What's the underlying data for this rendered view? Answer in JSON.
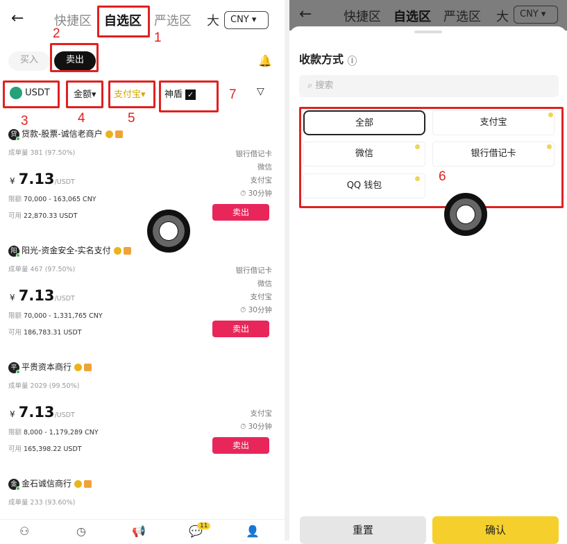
{
  "left": {
    "tabs": [
      "快捷区",
      "自选区",
      "严选区",
      "大"
    ],
    "currency": "CNY",
    "buy_label": "买入",
    "sell_label": "卖出",
    "filters": {
      "coin": "USDT",
      "amount": "金额",
      "payment": "支付宝",
      "shield": "神盾"
    },
    "merchants": [
      {
        "name": "贷款-股票-诚信老商户",
        "avatar": "贷",
        "stats_label": "成单量",
        "stats": "381 (97.50%)",
        "currency_symbol": "¥",
        "price": "7.13",
        "unit": "/USDT",
        "limit_label": "限额",
        "limit": "70,000 - 163,065 CNY",
        "avail_label": "可用",
        "avail": "22,870.33 USDT",
        "payments": [
          "银行借记卡",
          "微信",
          "支付宝"
        ],
        "time": "30分钟",
        "button": "卖出"
      },
      {
        "name": "阳光-资金安全-实名支付",
        "avatar": "阳",
        "stats_label": "成单量",
        "stats": "467 (97.50%)",
        "currency_symbol": "¥",
        "price": "7.13",
        "unit": "/USDT",
        "limit_label": "限额",
        "limit": "70,000 - 1,331,765 CNY",
        "avail_label": "可用",
        "avail": "186,783.31 USDT",
        "payments": [
          "银行借记卡",
          "微信",
          "支付宝"
        ],
        "time": "30分钟",
        "button": "卖出"
      },
      {
        "name": "平贵资本商行",
        "avatar": "平",
        "stats_label": "成单量",
        "stats": "2029 (99.50%)",
        "currency_symbol": "¥",
        "price": "7.13",
        "unit": "/USDT",
        "limit_label": "限额",
        "limit": "8,000 - 1,179,289 CNY",
        "avail_label": "可用",
        "avail": "165,398.22 USDT",
        "payments": [
          "支付宝"
        ],
        "time": "30分钟",
        "button": "卖出"
      },
      {
        "name": "金石诚信商行",
        "avatar": "金",
        "stats_label": "成单量",
        "stats": "233 (93.60%)"
      }
    ],
    "nav_badge": "11"
  },
  "right": {
    "tabs": [
      "快捷区",
      "自选区",
      "严选区",
      "大"
    ],
    "currency": "CNY",
    "panel_title": "收款方式",
    "search_placeholder": "搜索",
    "options": [
      "全部",
      "支付宝",
      "微信",
      "银行借记卡",
      "QQ 钱包"
    ],
    "reset": "重置",
    "confirm": "确认"
  },
  "annotations": [
    "1",
    "2",
    "3",
    "4",
    "5",
    "6",
    "7"
  ],
  "colors": {
    "sell": "#e8265a",
    "confirm": "#f5d02c",
    "annotation": "#e02020"
  }
}
